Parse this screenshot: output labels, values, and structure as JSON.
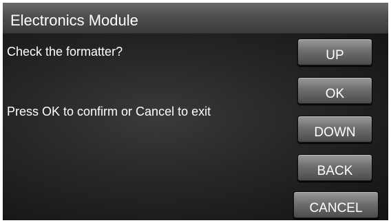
{
  "title": "Electronics Module",
  "message": {
    "question": "Check the formatter?",
    "instruction": "Press OK to confirm or Cancel to exit"
  },
  "buttons": {
    "up": "UP",
    "ok": "OK",
    "down": "DOWN",
    "back": "BACK",
    "cancel": "CANCEL"
  },
  "colors": {
    "background": "#111111",
    "title_bar": "#4e4e4e",
    "button": "#6e6e6e",
    "text": "#ffffff"
  }
}
